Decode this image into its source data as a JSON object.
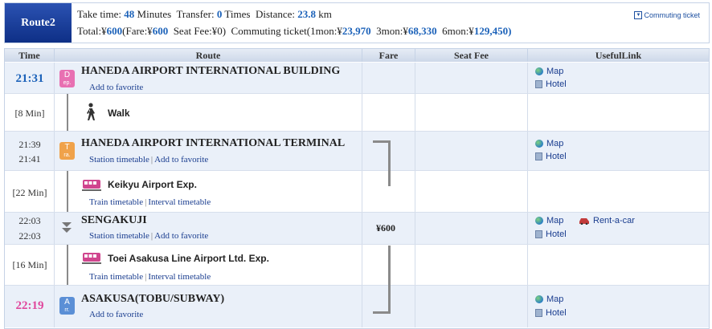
{
  "header": {
    "route_label": "Route2",
    "take_time_label": "Take time:",
    "take_time_value": "48",
    "minutes_unit": "Minutes",
    "transfer_label": "Transfer:",
    "transfer_value": "0",
    "times_unit": "Times",
    "distance_label": "Distance:",
    "distance_value": "23.8",
    "distance_unit": "km",
    "total_label": "Total:¥",
    "total_value": "600",
    "fare_label": "(Fare:¥",
    "fare_value": "600",
    "seat_fee_label": "Seat Fee:¥",
    "seat_fee_value": "0)",
    "commuting_label": "Commuting ticket(1mon:¥",
    "mon1_value": "23,970",
    "mon3_label": "3mon:¥",
    "mon3_value": "68,330",
    "mon6_label": "6mon:¥",
    "mon6_value": "129,450)",
    "commuting_link": "Commuting ticket"
  },
  "columns": {
    "time": "Time",
    "route": "Route",
    "fare": "Fare",
    "seat_fee": "Seat Fee",
    "useful_link": "UsefulLink"
  },
  "stations": [
    {
      "time": "21:31",
      "badge_top": "D",
      "badge_bottom": "ep.",
      "name": "HANEDA AIRPORT INTERNATIONAL BUILDING",
      "link_favorite": "Add to favorite",
      "map": "Map",
      "hotel": "Hotel"
    },
    {
      "time_arr": "21:39",
      "time_dep": "21:41",
      "badge_top": "T",
      "badge_bottom": "ra.",
      "name": "HANEDA AIRPORT INTERNATIONAL TERMINAL",
      "link_timetable": "Station timetable",
      "link_favorite": "Add to favorite",
      "map": "Map",
      "hotel": "Hotel"
    },
    {
      "time_arr": "22:03",
      "time_dep": "22:03",
      "name": "SENGAKUJI",
      "link_timetable": "Station timetable",
      "link_favorite": "Add to favorite",
      "map": "Map",
      "rentacar": "Rent-a-car",
      "hotel": "Hotel"
    },
    {
      "time": "22:19",
      "badge_top": "A",
      "badge_bottom": "rr.",
      "name": "ASAKUSA(TOBU/SUBWAY)",
      "link_favorite": "Add to favorite",
      "map": "Map",
      "hotel": "Hotel"
    }
  ],
  "segments": [
    {
      "duration": "[8 Min]",
      "name": "Walk"
    },
    {
      "duration": "[22 Min]",
      "name": "Keikyu Airport Exp.",
      "link_train": "Train timetable",
      "link_interval": "Interval timetable"
    },
    {
      "duration": "[16 Min]",
      "name": "Toei Asakusa Line Airport Ltd. Exp.",
      "link_train": "Train timetable",
      "link_interval": "Interval timetable"
    }
  ],
  "fare_value": "¥600",
  "colors": {
    "accent_blue": "#1c62b9",
    "arrival_pink": "#e0469c",
    "depart_badge": "#e870b2",
    "transfer_badge": "#f0a24a",
    "arrive_badge": "#5b8fd6"
  },
  "icons": [
    "walk-icon",
    "train-icon",
    "globe-icon",
    "hotel-icon",
    "car-icon",
    "pass-through-icon"
  ]
}
